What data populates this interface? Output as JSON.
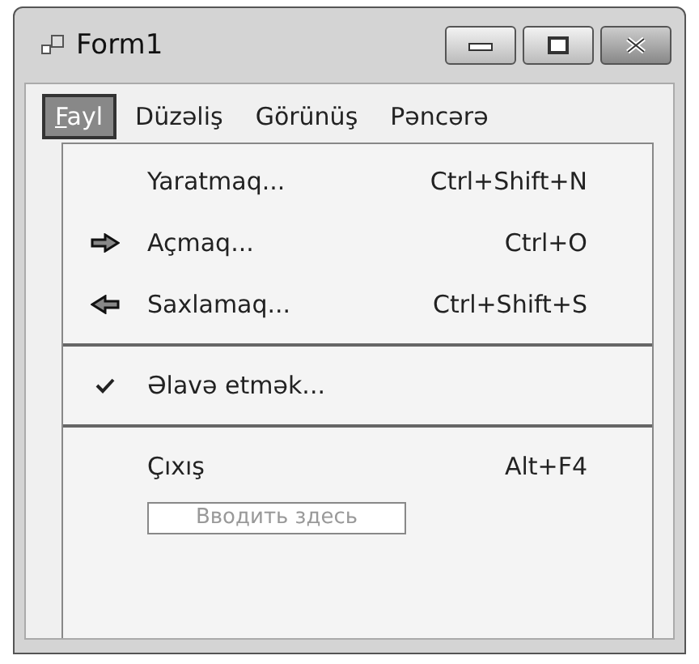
{
  "window": {
    "title": "Form1"
  },
  "menu_bar": [
    {
      "label": "Fayl",
      "selected": true
    },
    {
      "label": "Düzəliş",
      "selected": false
    },
    {
      "label": "Görünüş",
      "selected": false
    },
    {
      "label": "Pəncərə",
      "selected": false
    }
  ],
  "dropdown": [
    {
      "kind": "item",
      "label": "Yaratmaq...",
      "shortcut": "Ctrl+Shift+N",
      "checked": false
    },
    {
      "kind": "forward",
      "label": "Açmaq...",
      "shortcut": "Ctrl+O",
      "checked": false
    },
    {
      "kind": "back",
      "label": "Saxlamaq...",
      "shortcut": "Ctrl+Shift+S",
      "checked": false
    },
    {
      "kind": "separator"
    },
    {
      "kind": "item",
      "label": "Əlavə etmək...",
      "checked": true
    },
    {
      "kind": "separator"
    },
    {
      "kind": "item",
      "label": "Çıxış",
      "shortcut": "Alt+F4",
      "checked": false
    },
    {
      "kind": "textbox",
      "placeholder": "Вводить здесь"
    }
  ]
}
